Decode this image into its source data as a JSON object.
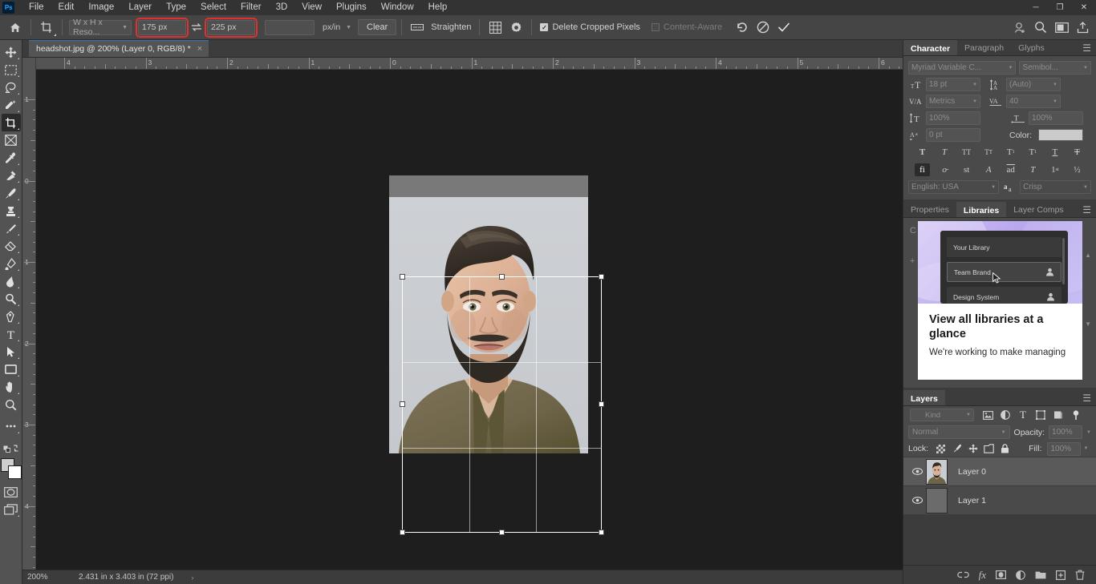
{
  "app": {
    "name": "Adobe Photoshop",
    "logo_text": "Ps"
  },
  "menubar": {
    "items": [
      "File",
      "Edit",
      "Image",
      "Layer",
      "Type",
      "Select",
      "Filter",
      "3D",
      "View",
      "Plugins",
      "Window",
      "Help"
    ],
    "window_controls": [
      "minimize",
      "restore",
      "close"
    ]
  },
  "options_bar": {
    "home_icon": "home-icon",
    "tool_icon": "crop-tool-icon",
    "preset_select": "W x H x Reso...",
    "width_value": "175 px",
    "swap_icon": "swap-arrows-icon",
    "height_value": "225 px",
    "resolution_value": "",
    "resolution_unit": "px/in",
    "clear_label": "Clear",
    "straighten_icon": "straighten-icon",
    "straighten_label": "Straighten",
    "overlay_icon": "grid-overlay-icon",
    "settings_icon": "gear-icon",
    "delete_cropped_label": "Delete Cropped Pixels",
    "delete_cropped_checked": true,
    "content_aware_label": "Content-Aware",
    "content_aware_checked": false,
    "reset_icon": "reset-arrow-icon",
    "cancel_icon": "cancel-circle-icon",
    "commit_icon": "checkmark-icon",
    "highlight_color": "#e03030",
    "right_icons": [
      "share-person-icon",
      "search-icon",
      "workspace-icon",
      "export-icon"
    ]
  },
  "toolbar": {
    "tools": [
      {
        "name": "move-tool",
        "selected": false
      },
      {
        "name": "rectangular-marquee-tool",
        "selected": false
      },
      {
        "name": "lasso-tool",
        "selected": false
      },
      {
        "name": "object-selection-tool",
        "selected": false
      },
      {
        "name": "crop-tool",
        "selected": true
      },
      {
        "name": "frame-tool",
        "selected": false
      },
      {
        "name": "eyedropper-tool",
        "selected": false
      },
      {
        "name": "spot-healing-brush-tool",
        "selected": false
      },
      {
        "name": "brush-tool",
        "selected": false
      },
      {
        "name": "clone-stamp-tool",
        "selected": false
      },
      {
        "name": "history-brush-tool",
        "selected": false
      },
      {
        "name": "eraser-tool",
        "selected": false
      },
      {
        "name": "gradient-tool",
        "selected": false
      },
      {
        "name": "blur-tool",
        "selected": false
      },
      {
        "name": "dodge-tool",
        "selected": false
      },
      {
        "name": "pen-tool",
        "selected": false
      },
      {
        "name": "type-tool",
        "selected": false
      },
      {
        "name": "path-selection-tool",
        "selected": false
      },
      {
        "name": "rectangle-tool",
        "selected": false
      },
      {
        "name": "hand-tool",
        "selected": false
      },
      {
        "name": "zoom-tool",
        "selected": false
      },
      {
        "name": "edit-toolbar-icon",
        "selected": false
      }
    ],
    "foreground_color": "#cfcfcf",
    "background_color": "#ffffff",
    "quick_mask_icon": "quick-mask-icon",
    "screen_mode_icon": "screen-mode-icon"
  },
  "document": {
    "tab_title": "headshot.jpg @ 200% (Layer 0, RGB/8) *",
    "close_glyph": "×",
    "ruler_h_labels": [
      "4",
      "3",
      "2",
      "1",
      "0",
      "1",
      "2",
      "3",
      "4",
      "5",
      "6"
    ],
    "ruler_v_labels": [
      "1",
      "0",
      "1",
      "2",
      "3",
      "4"
    ],
    "crop_overlay": "rule-of-thirds"
  },
  "statusbar": {
    "zoom": "200%",
    "dimensions": "2.431 in x 3.403 in (72 ppi)",
    "expander": "›"
  },
  "character_panel": {
    "tabs": [
      {
        "label": "Character",
        "active": true
      },
      {
        "label": "Paragraph",
        "active": false
      },
      {
        "label": "Glyphs",
        "active": false
      }
    ],
    "menu_icon": "panel-menu-icon",
    "font_family": "Myriad Variable C...",
    "font_style": "Semibol...",
    "font_size": "18 pt",
    "leading": "(Auto)",
    "kerning": "Metrics",
    "tracking": "40",
    "vertical_scale": "100%",
    "horizontal_scale": "100%",
    "baseline_shift": "0 pt",
    "color_label": "Color:",
    "color_value": "#cacaca",
    "style_buttons": [
      "bold-icon",
      "italic-icon",
      "all-caps-icon",
      "small-caps-icon",
      "superscript-icon",
      "subscript-icon",
      "underline-icon",
      "strikethrough-icon"
    ],
    "opentype_buttons": [
      "standard-ligatures-icon",
      "contextual-alternates-icon",
      "discretionary-ligatures-icon",
      "swash-icon",
      "oldstyle-icon",
      "titling-alternates-icon",
      "ordinals-icon",
      "fractions-icon"
    ],
    "language": "English: USA",
    "aa_icon": "anti-alias-icon",
    "anti_alias": "Crisp"
  },
  "libraries_panel": {
    "tabs": [
      {
        "label": "Properties",
        "active": false
      },
      {
        "label": "Libraries",
        "active": true
      },
      {
        "label": "Layer Comps",
        "active": false
      }
    ],
    "menu_icon": "panel-menu-icon",
    "popup": {
      "items": [
        "Your Library",
        "Team Brand",
        "Design System"
      ],
      "highlighted_item": "Team Brand",
      "person_icon": "person-icon",
      "cursor_icon": "cursor-arrow-icon",
      "title": "View all libraries at a glance",
      "body": "We're working to make managing"
    }
  },
  "layers_panel": {
    "tabs": [
      {
        "label": "Layers",
        "active": true
      }
    ],
    "menu_icon": "panel-menu-icon",
    "filter_placeholder": "Kind",
    "search_icon": "search-icon",
    "filter_icons": [
      "pixel-layer-filter-icon",
      "adjustment-layer-filter-icon",
      "type-layer-filter-icon",
      "shape-layer-filter-icon",
      "smart-object-filter-icon",
      "toggle-filter-icon"
    ],
    "blend_mode": "Normal",
    "opacity_label": "Opacity:",
    "opacity_value": "100%",
    "lock_label": "Lock:",
    "lock_icons": [
      "lock-transparent-pixels-icon",
      "lock-image-pixels-icon",
      "lock-position-icon",
      "lock-artboard-icon",
      "lock-all-icon"
    ],
    "fill_label": "Fill:",
    "fill_value": "100%",
    "layers": [
      {
        "name": "Layer 0",
        "visible": true,
        "selected": true,
        "thumb": "photo"
      },
      {
        "name": "Layer 1",
        "visible": true,
        "selected": false,
        "thumb": "transparent"
      }
    ],
    "footer_icons": [
      "link-layers-icon",
      "add-layer-style-icon",
      "add-layer-mask-icon",
      "new-adjustment-layer-icon",
      "new-group-icon",
      "new-layer-icon",
      "delete-layer-icon"
    ]
  }
}
